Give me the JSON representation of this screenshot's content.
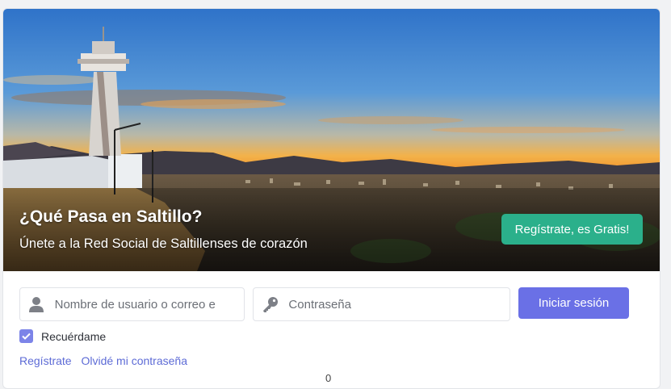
{
  "hero": {
    "title": "¿Qué Pasa en Saltillo?",
    "subtitle": "Únete a la Red Social de Saltillenses de corazón",
    "register_cta": "Regístrate, es Gratis!"
  },
  "login": {
    "username_placeholder": "Nombre de usuario o correo e",
    "password_placeholder": "Contraseña",
    "submit_label": "Iniciar sesión",
    "remember_label": "Recuérdame",
    "remember_checked": true
  },
  "links": {
    "register": "Regístrate",
    "forgot_password": "Olvidé mi contraseña"
  },
  "footer": {
    "counter": "0"
  },
  "colors": {
    "cta_green": "#2bb08b",
    "primary_purple": "#6a70e6",
    "link_blue": "#5d6bd6"
  },
  "icons": {
    "username": "user-icon",
    "password": "key-icon",
    "checkbox": "check-icon"
  }
}
